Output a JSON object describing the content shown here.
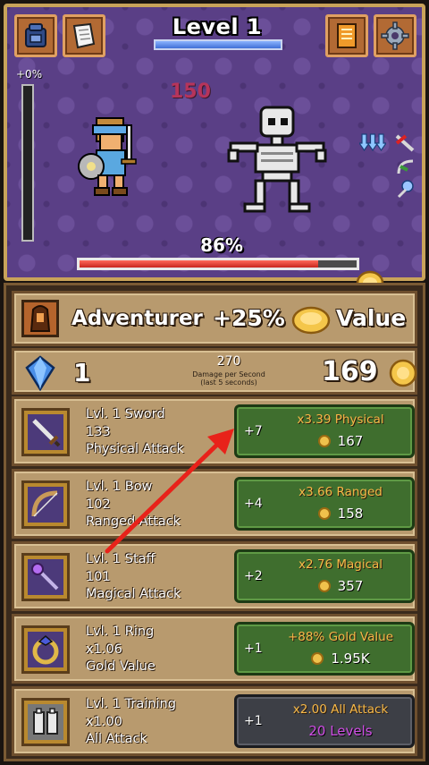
{
  "level": {
    "title": "Level 1",
    "progress": 1.0
  },
  "battle": {
    "gold_bonus_pct": "+0%",
    "gold_bar_fill": 0.0,
    "damage_number": "150",
    "monster_hp_pct_text": "86%",
    "monster_hp_fill": 0.86,
    "buff_icons": [
      "attack-down-buff-icon",
      "sword-buff-icon",
      "bow-buff-icon",
      "staff-buff-icon"
    ]
  },
  "top_buttons": {
    "left": [
      "backpack-icon",
      "scroll-icon"
    ],
    "right": [
      "spellbook-icon",
      "gear-icon"
    ]
  },
  "class_row": {
    "name": "Adventurer",
    "bonus_pct": "+25%",
    "bonus_label": "Value"
  },
  "stats_row": {
    "gems": "1",
    "dps_value": "270",
    "dps_label": "Damage per Second",
    "dps_sub": "(last 5 seconds)",
    "gold": "169"
  },
  "upgrades": [
    {
      "icon": "sword-icon",
      "line1": "Lvl. 1 Sword",
      "line2": "133",
      "line3": "Physical Attack",
      "count": "+7",
      "effect": "x3.39 Physical",
      "price": "167",
      "locked": false
    },
    {
      "icon": "bow-icon",
      "line1": "Lvl. 1 Bow",
      "line2": "102",
      "line3": "Ranged Attack",
      "count": "+4",
      "effect": "x3.66 Ranged",
      "price": "158",
      "locked": false
    },
    {
      "icon": "staff-icon",
      "line1": "Lvl. 1 Staff",
      "line2": "101",
      "line3": "Magical Attack",
      "count": "+2",
      "effect": "x2.76 Magical",
      "price": "357",
      "locked": false
    },
    {
      "icon": "ring-icon",
      "line1": "Lvl. 1 Ring",
      "line2": "x1.06",
      "line3": "Gold Value",
      "count": "+1",
      "effect": "+88% Gold Value",
      "price": "1.95K",
      "locked": false
    },
    {
      "icon": "training-icon",
      "line1": "Lvl. 1 Training",
      "line2": "x1.00",
      "line3": "All Attack",
      "count": "+1",
      "effect": "x2.00 All Attack",
      "price": "20 Levels",
      "locked": true
    }
  ],
  "colors": {
    "panel_green": "#3f6e2e",
    "locked_grey": "#3d3f46",
    "price_orange": "#f6b848",
    "levels_purple": "#d04ee6",
    "annotation_arrow": "#e8221a"
  }
}
